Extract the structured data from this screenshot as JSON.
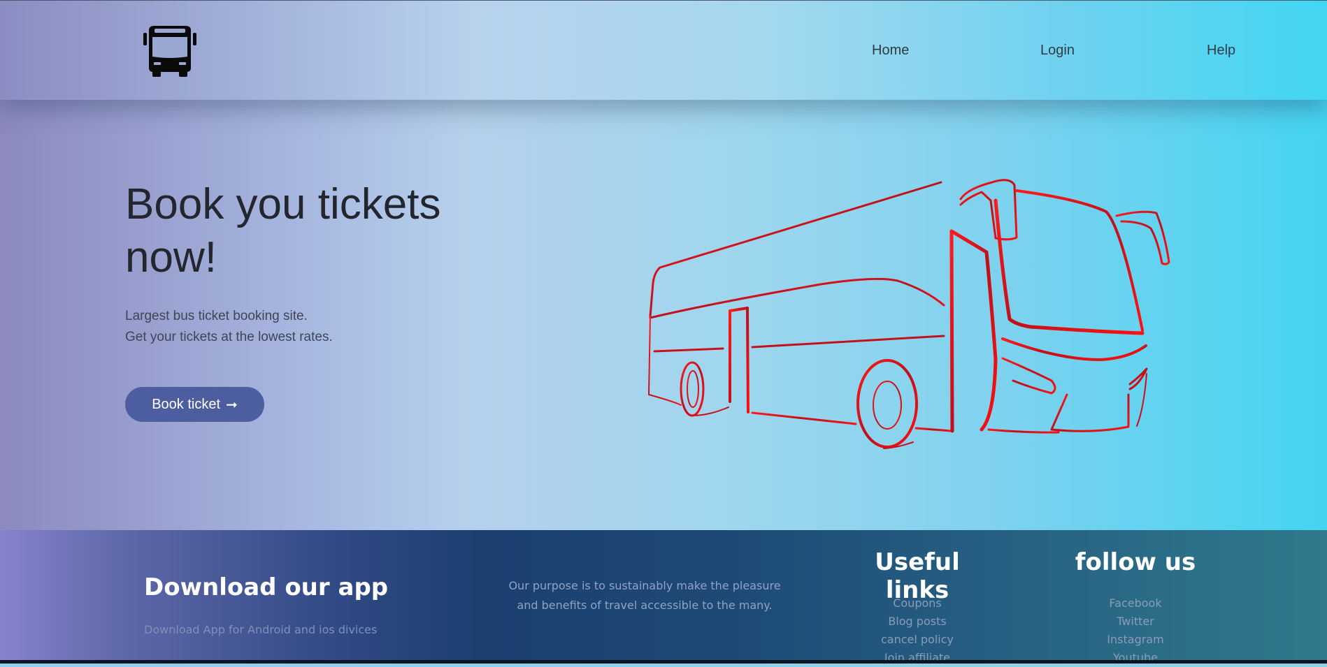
{
  "nav": {
    "items": [
      {
        "label": "Home"
      },
      {
        "label": "Login"
      },
      {
        "label": "Help"
      }
    ]
  },
  "hero": {
    "title": "Book you tickets now!",
    "subtitle_line1": "Largest bus ticket booking site.",
    "subtitle_line2": "Get your tickets at the lowest rates.",
    "button_label": "Book ticket",
    "button_arrow": "➞"
  },
  "footer": {
    "app_title": "Download our app",
    "app_subtitle": "Download App for Android and ios divices",
    "purpose": "Our purpose is to sustainably make the pleasure and benefits of travel accessible to the many.",
    "useful_links_title": "Useful links",
    "useful_links": [
      "Coupons",
      "Blog posts",
      "cancel policy",
      "Join affiliate"
    ],
    "follow_title": "follow us",
    "follow_links": [
      "Facebook",
      "Twitter",
      "Instagram",
      "Youtube"
    ]
  },
  "icons": {
    "logo": "bus-icon",
    "illustration": "bus-outline-illustration"
  },
  "colors": {
    "button": "#4d5ea0",
    "illustration_stroke": "#e0141c"
  }
}
